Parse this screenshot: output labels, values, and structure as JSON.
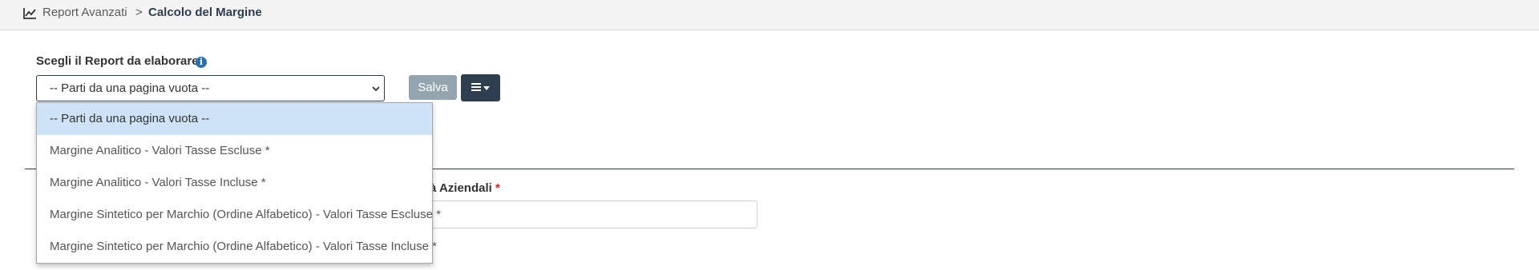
{
  "breadcrumb": {
    "icon": "line-chart-icon",
    "parent": "Report Avanzati",
    "separator": ">",
    "current": "Calcolo del Margine"
  },
  "report_select": {
    "label": "Scegli il Report da elaborare",
    "info_icon": "info-icon",
    "value": "-- Parti da una pagina vuota --",
    "options": [
      "-- Parti da una pagina vuota --",
      "Margine Analitico - Valori Tasse Escluse *",
      "Margine Analitico - Valori Tasse Incluse *",
      "Margine Sintetico per Marchio (Ordine Alfabetico) - Valori Tasse Escluse *",
      "Margine Sintetico per Marchio (Ordine Alfabetico) - Valori Tasse Incluse *"
    ],
    "selected_index": 0
  },
  "toolbar": {
    "save_label": "Salva",
    "menu_icon": "hamburger-icon"
  },
  "second_field": {
    "label_visible": "à Aziendali",
    "required_mark": "*"
  },
  "colors": {
    "primary_dark": "#2c3e50",
    "save_disabled": "#95a5b0",
    "option_selected": "#cfe3f8",
    "required": "#e02020",
    "info": "#2a6fb0"
  }
}
